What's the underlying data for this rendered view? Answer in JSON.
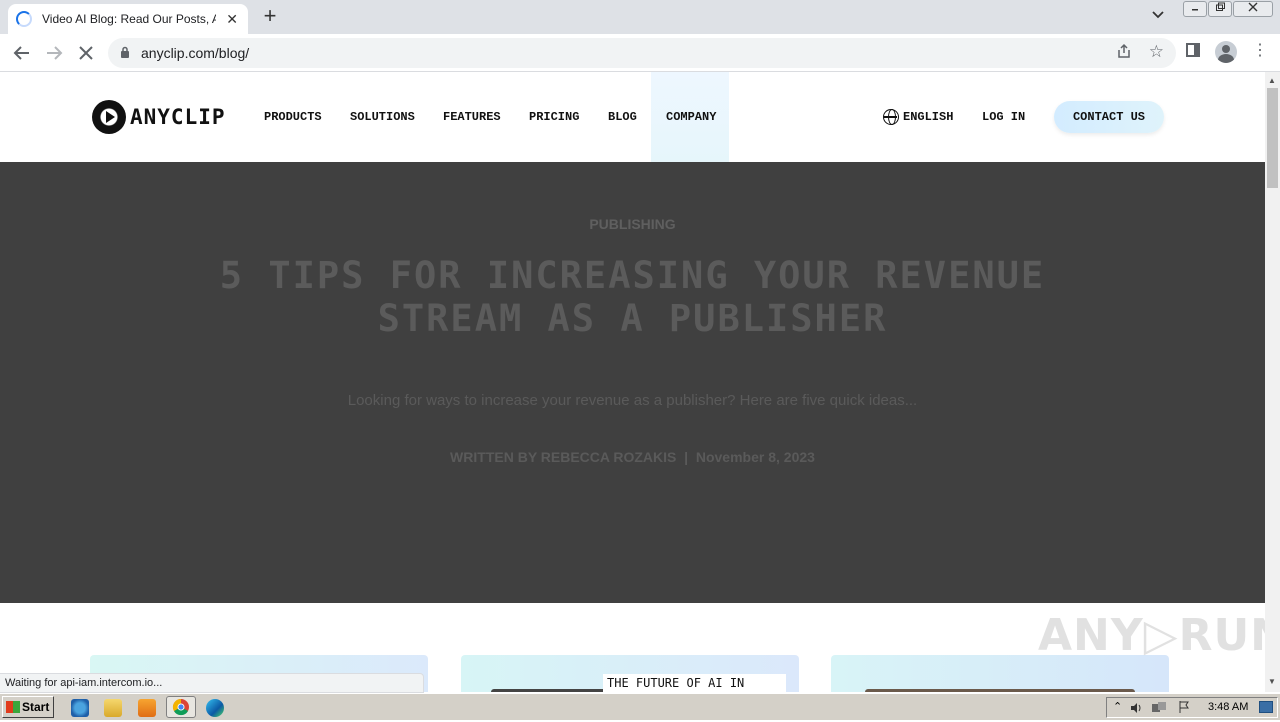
{
  "browser": {
    "tab_title": "Video AI Blog: Read Our Posts, Artic",
    "tab_close": "✕",
    "new_tab": "+",
    "tab_list": "⌄",
    "url": "anyclip.com/blog/",
    "back": "←",
    "forward": "→",
    "reload": "✕",
    "share": "⇪",
    "star": "☆",
    "menu": "⋮",
    "status_text": "Waiting for api-iam.intercom.io..."
  },
  "site": {
    "logo_text": "ANYCLIP",
    "nav": {
      "products": "PRODUCTS",
      "solutions": "SOLUTIONS",
      "features": "FEATURES",
      "pricing": "PRICING",
      "blog": "BLOG",
      "company": "COMPANY"
    },
    "language": "ENGLISH",
    "login": "LOG IN",
    "contact": "CONTACT US"
  },
  "hero": {
    "category": "PUBLISHING",
    "headline": "5 TIPS FOR INCREASING YOUR REVENUE STREAM AS A PUBLISHER",
    "excerpt": "Looking for ways to increase your revenue as a publisher? Here are five quick ideas...",
    "byline": "WRITTEN BY REBECCA ROZAKIS  |  November 8, 2023"
  },
  "cards": {
    "card2_label": "THE FUTURE OF AI IN VIDEO BUSINESS"
  },
  "watermark": "ANY▷RUN",
  "taskbar": {
    "start": "Start",
    "clock": "3:48 AM"
  },
  "colors": {
    "hero_bg": "#404040",
    "contact_bg": "#d3ecff",
    "chrome_accent": "#1a73e8"
  }
}
